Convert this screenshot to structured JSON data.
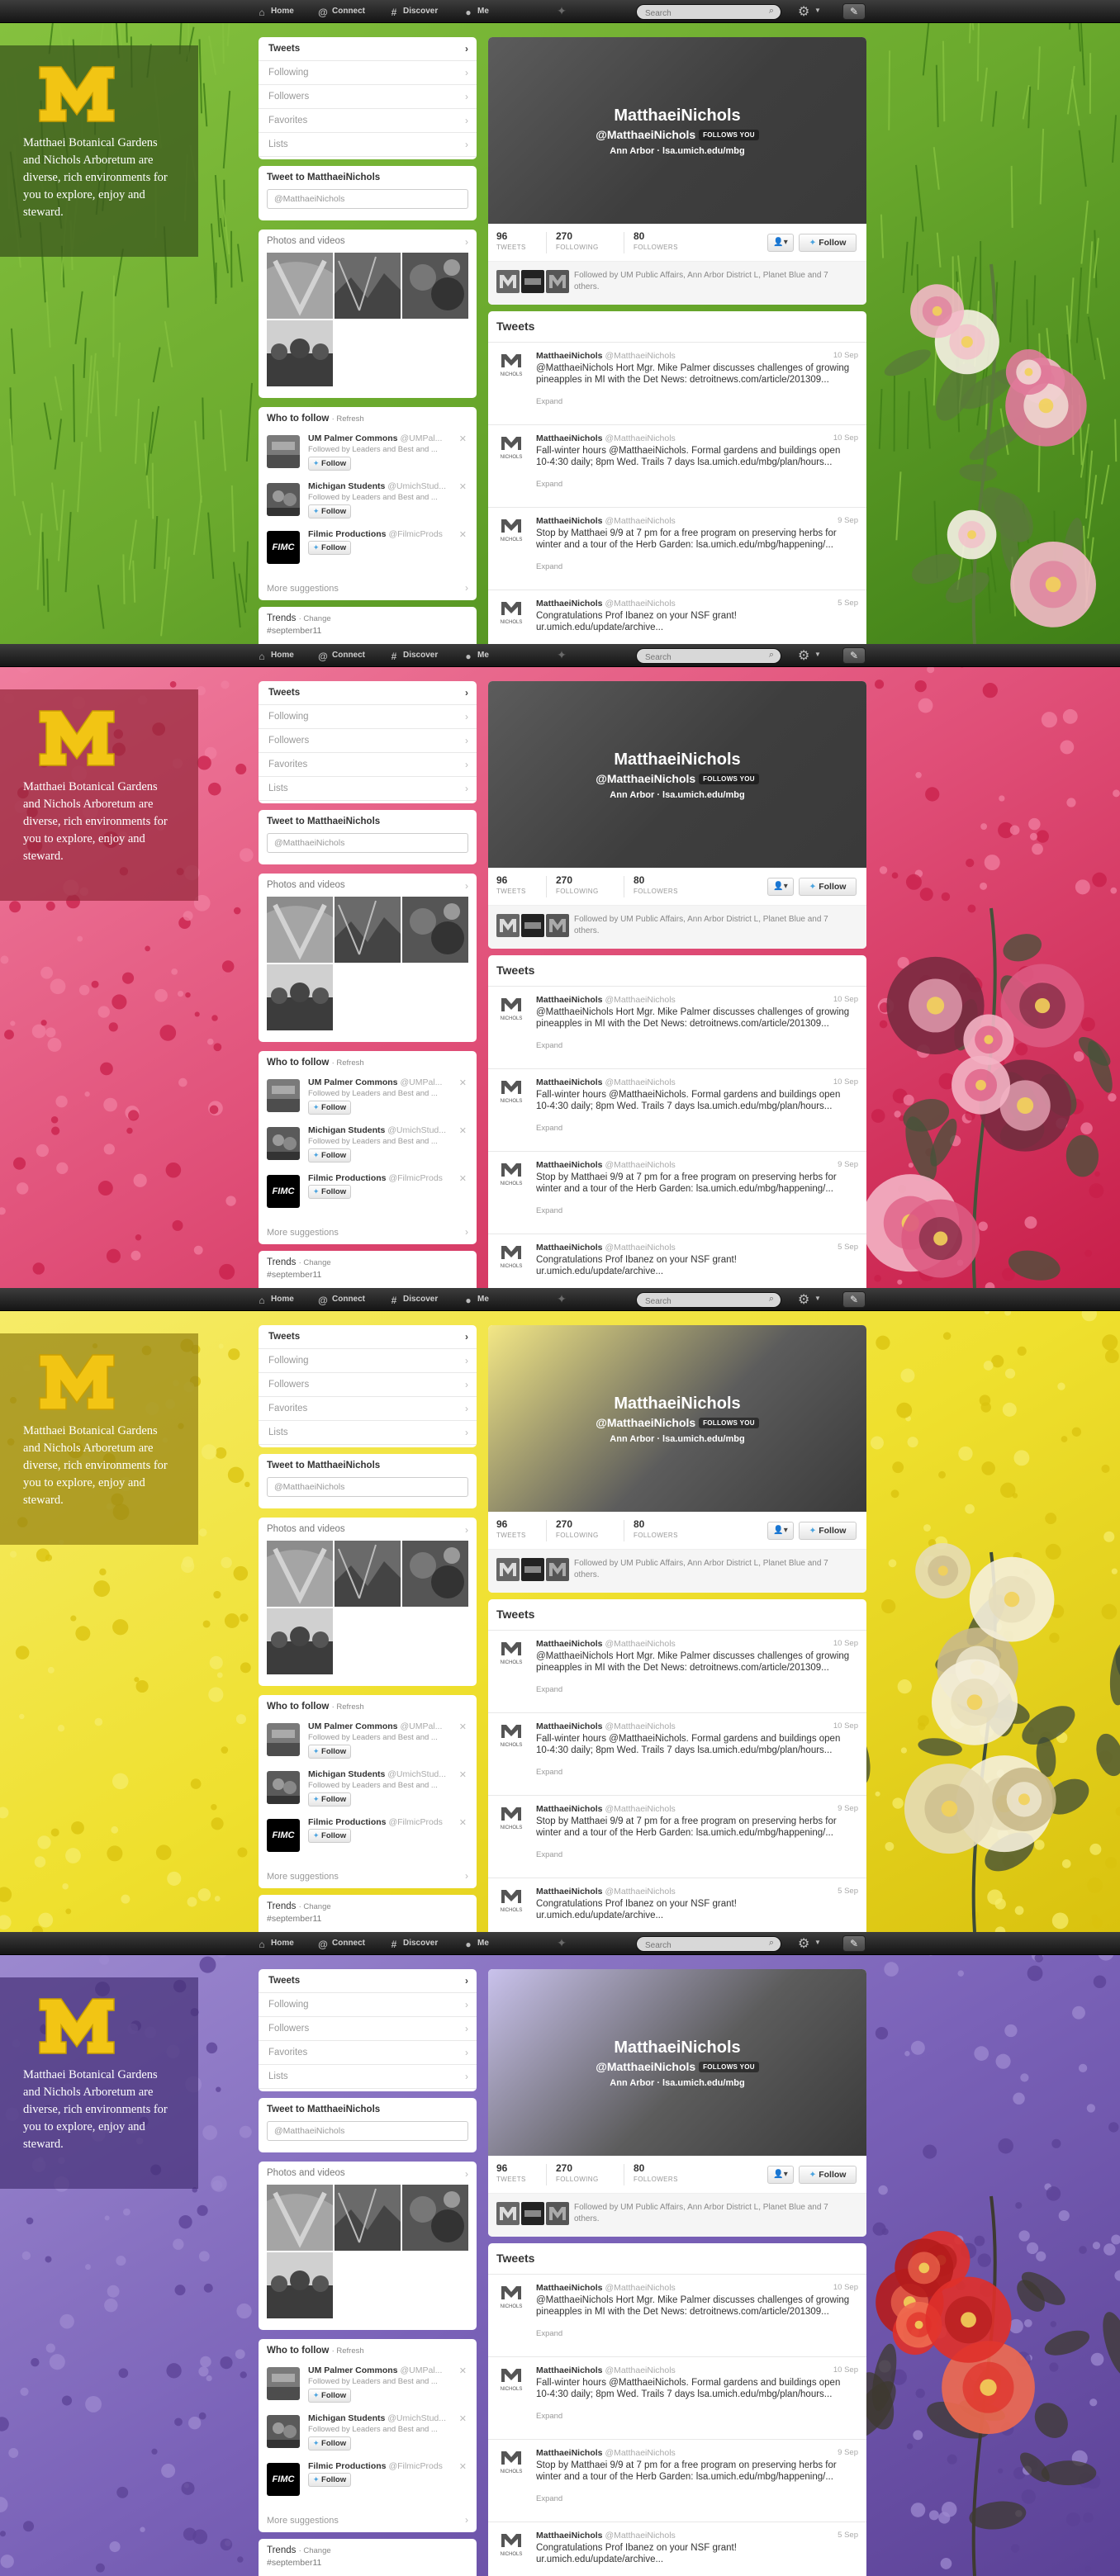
{
  "nav": {
    "home": "Home",
    "connect": "Connect",
    "discover": "Discover",
    "me": "Me",
    "search_placeholder": "Search"
  },
  "brand": {
    "logo_letter": "M",
    "text": "Matthaei Botanical Gardens and Nichols Arboretum are diverse, rich environments for you to explore, enjoy and steward."
  },
  "left_nav": {
    "items": [
      "Tweets",
      "Following",
      "Followers",
      "Favorites",
      "Lists"
    ]
  },
  "tweet_to": {
    "label": "Tweet to MatthaeiNichols",
    "value": "@MatthaeiNichols"
  },
  "photos": {
    "label": "Photos and videos"
  },
  "who_to_follow": {
    "title": "Who to follow",
    "refresh": "· Refresh",
    "follow_label": "Follow",
    "more": "More suggestions",
    "suggestions": [
      {
        "name": "UM Palmer Commons",
        "handle": "@UMPal...",
        "sub": "Followed by Leaders and Best and ..."
      },
      {
        "name": "Michigan Students",
        "handle": "@UmichStud...",
        "sub": "Followed by Leaders and Best and ..."
      },
      {
        "name": "Filmic Productions",
        "handle": "@FilmicProds",
        "sub": ""
      }
    ],
    "filmic_logo": "FIMC"
  },
  "trends": {
    "title": "Trends",
    "change": "· Change",
    "tag": "#september11"
  },
  "profile": {
    "name": "MatthaeiNichols",
    "handle": "@MatthaeiNichols",
    "follows_you": "FOLLOWS YOU",
    "location": "Ann Arbor · lsa.umich.edu/mbg",
    "stats": [
      {
        "num": "96",
        "label": "TWEETS"
      },
      {
        "num": "270",
        "label": "FOLLOWING"
      },
      {
        "num": "80",
        "label": "FOLLOWERS"
      }
    ],
    "follow_label": "Follow",
    "user_btn": "👤▾",
    "followed_by": "Followed by UM Public Affairs, Ann Arbor District L, Planet Blue and 7 others."
  },
  "tweets": {
    "title": "Tweets",
    "expand": "Expand",
    "items": [
      {
        "name": "MatthaeiNichols",
        "handle": "@MatthaeiNichols",
        "date": "10 Sep",
        "body": "@MatthaeiNichols Hort Mgr. Mike Palmer discusses challenges of growing pineapples in MI with the Det News: detroitnews.com/article/201309..."
      },
      {
        "name": "MatthaeiNichols",
        "handle": "@MatthaeiNichols",
        "date": "10 Sep",
        "body": "Fall-winter hours @MatthaeiNichols. Formal gardens and buildings open 10-4:30 daily; 8pm Wed. Trails 7 days lsa.umich.edu/mbg/plan/hours..."
      },
      {
        "name": "MatthaeiNichols",
        "handle": "@MatthaeiNichols",
        "date": "9 Sep",
        "body": "Stop by Matthaei 9/9 at 7 pm for a free program on preserving herbs for winter and a tour of the Herb Garden: lsa.umich.edu/mbg/happening/..."
      },
      {
        "name": "MatthaeiNichols",
        "handle": "@MatthaeiNichols",
        "date": "5 Sep",
        "body": "Congratulations Prof Ibanez on your NSF grant! ur.umich.edu/update/archive..."
      }
    ]
  },
  "colors": {
    "maize": "#f2c514",
    "panels": [
      {
        "theme": "green",
        "base": "#4e8d1f"
      },
      {
        "theme": "pink",
        "base": "#d9365e"
      },
      {
        "theme": "yellow",
        "base": "#e6d21a"
      },
      {
        "theme": "purple",
        "base": "#6b50a8"
      }
    ]
  }
}
